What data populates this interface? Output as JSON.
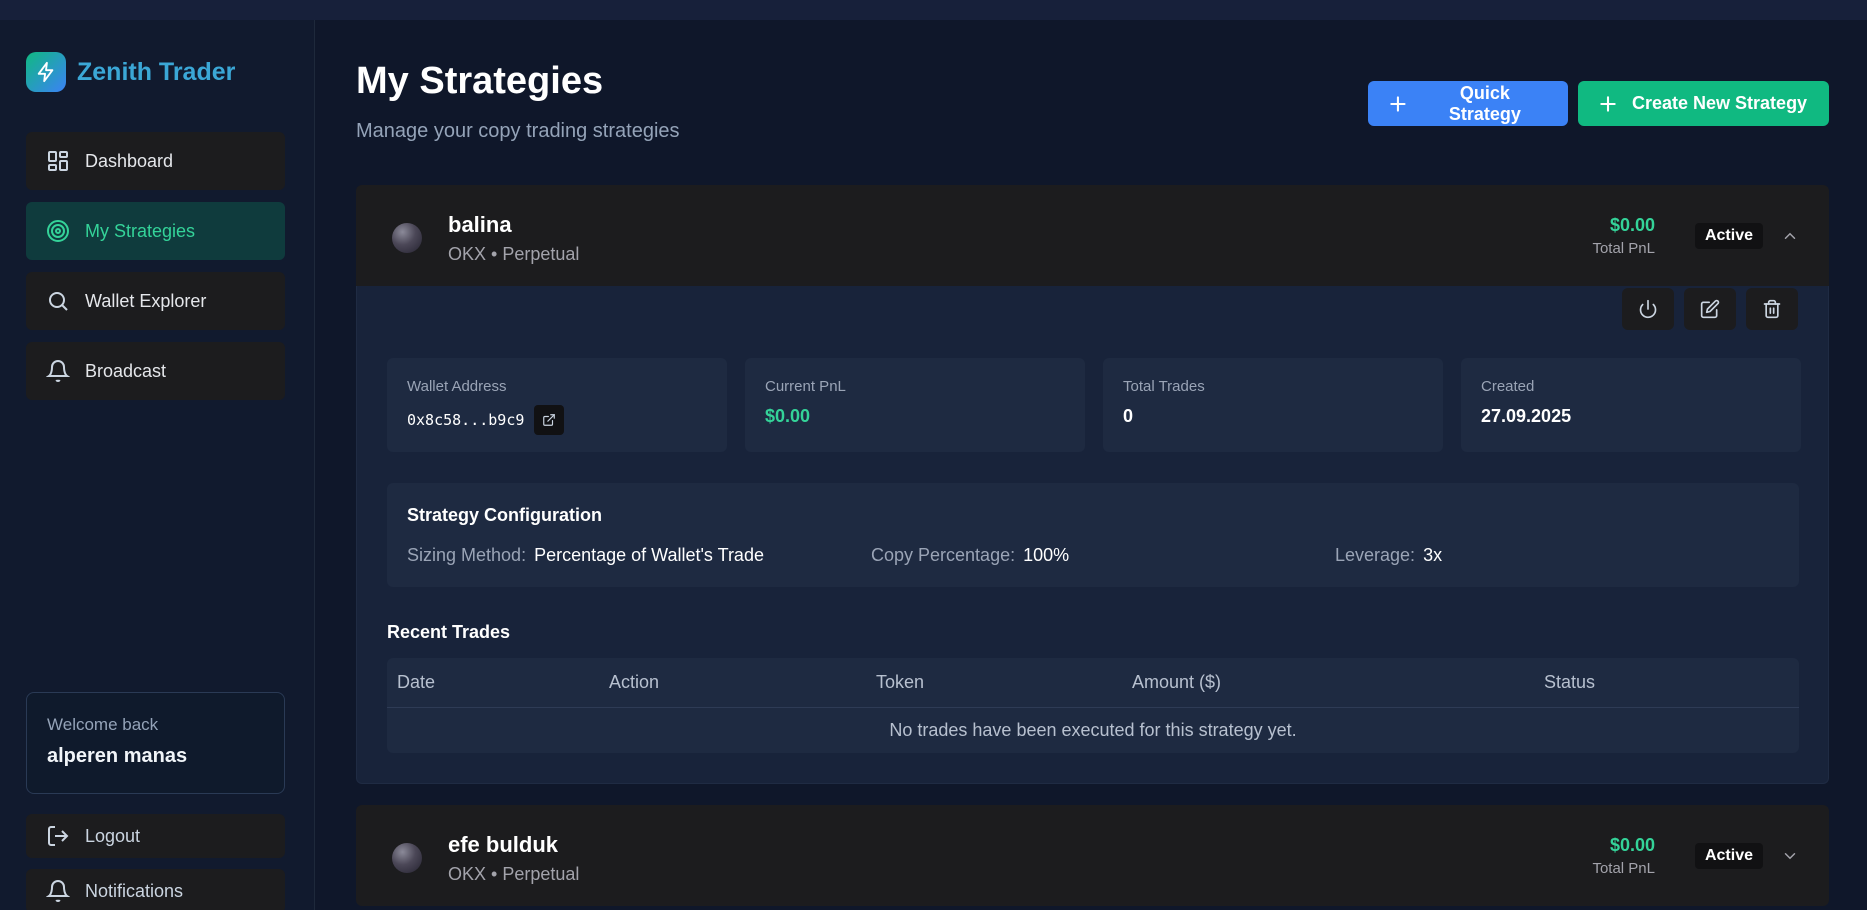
{
  "brand": {
    "name": "Zenith Trader"
  },
  "sidebar": {
    "items": [
      {
        "label": "Dashboard",
        "icon": "dashboard-icon",
        "active": false
      },
      {
        "label": "My Strategies",
        "icon": "target-icon",
        "active": true
      },
      {
        "label": "Wallet Explorer",
        "icon": "search-icon",
        "active": false
      },
      {
        "label": "Broadcast",
        "icon": "bell-icon",
        "active": false
      }
    ],
    "welcome": {
      "label": "Welcome back",
      "name": "alperen manas"
    },
    "bottom": [
      {
        "label": "Logout",
        "icon": "logout-icon"
      },
      {
        "label": "Notifications",
        "icon": "bell-icon"
      }
    ]
  },
  "header": {
    "title": "My Strategies",
    "subtitle": "Manage your copy trading strategies",
    "quick_label": "Quick Strategy",
    "create_label": "Create New Strategy"
  },
  "strategies": [
    {
      "name": "balina",
      "subtitle": "OKX • Perpetual",
      "pnl": "$0.00",
      "pnl_label": "Total PnL",
      "status": "Active",
      "expanded": true,
      "stats": [
        {
          "label": "Wallet Address",
          "value": "0x8c58...b9c9"
        },
        {
          "label": "Current PnL",
          "value": "$0.00"
        },
        {
          "label": "Total Trades",
          "value": "0"
        },
        {
          "label": "Created",
          "value": "27.09.2025"
        }
      ],
      "config": {
        "title": "Strategy Configuration",
        "sizing_label": "Sizing Method:",
        "sizing_value": "Percentage of Wallet's Trade",
        "copy_label": "Copy Percentage:",
        "copy_value": "100%",
        "leverage_label": "Leverage:",
        "leverage_value": "3x"
      },
      "recent": {
        "title": "Recent Trades",
        "columns": [
          "Date",
          "Action",
          "Token",
          "Amount ($)",
          "Status"
        ],
        "empty": "No trades have been executed for this strategy yet."
      }
    },
    {
      "name": "efe bulduk",
      "subtitle": "OKX • Perpetual",
      "pnl": "$0.00",
      "pnl_label": "Total PnL",
      "status": "Active",
      "expanded": false
    }
  ],
  "colors": {
    "background": "#0f172a",
    "sidebar": "#111a2e",
    "accent_green": "#10b981",
    "accent_blue": "#3b82f6",
    "pnl_green": "#34d399"
  }
}
